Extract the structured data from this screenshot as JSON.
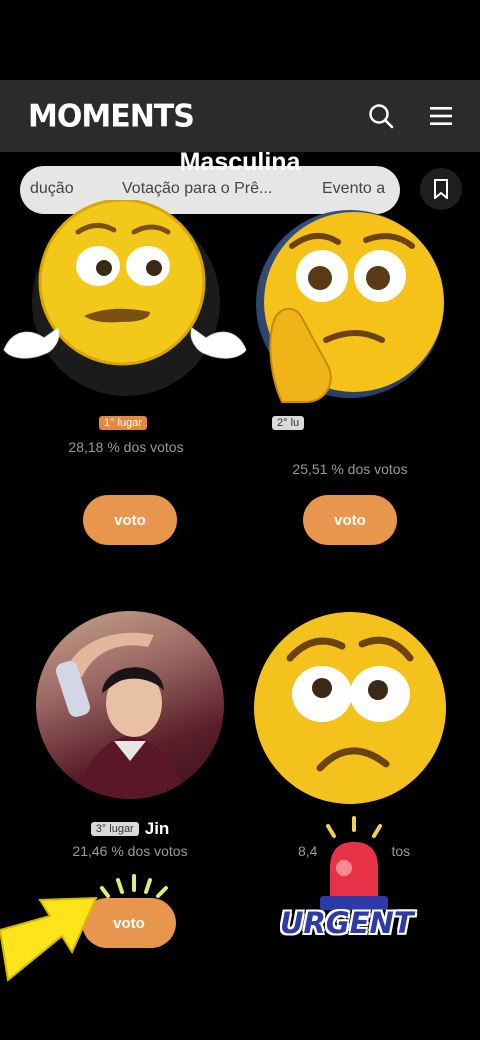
{
  "header": {
    "logo": "MOMENTS",
    "search_icon": "search-icon",
    "menu_icon": "menu-icon"
  },
  "category_title": "Masculina",
  "tabs": [
    {
      "label": "dução"
    },
    {
      "label": "Votação para o Prê..."
    },
    {
      "label": "Evento a"
    }
  ],
  "bookmark_icon": "bookmark-icon",
  "candidates": [
    {
      "rank": "1° lugar",
      "name": "",
      "percent": "28,18 % dos votos",
      "vote_label": "voto"
    },
    {
      "rank": "2° lu",
      "name": "",
      "percent": "25,51 % dos votos",
      "vote_label": "voto"
    },
    {
      "rank": "3° lugar",
      "name": "Jin",
      "percent": "21,46 % dos votos",
      "vote_label": "voto"
    },
    {
      "rank": "",
      "name": "",
      "percent": "8,4",
      "percent_tail": "tos",
      "vote_label": ""
    }
  ],
  "overlays": {
    "urgent": "URGENT"
  },
  "colors": {
    "accent": "#e8964e",
    "header_bg": "#2b2b2b",
    "tab_bg": "#e6e6e6"
  }
}
